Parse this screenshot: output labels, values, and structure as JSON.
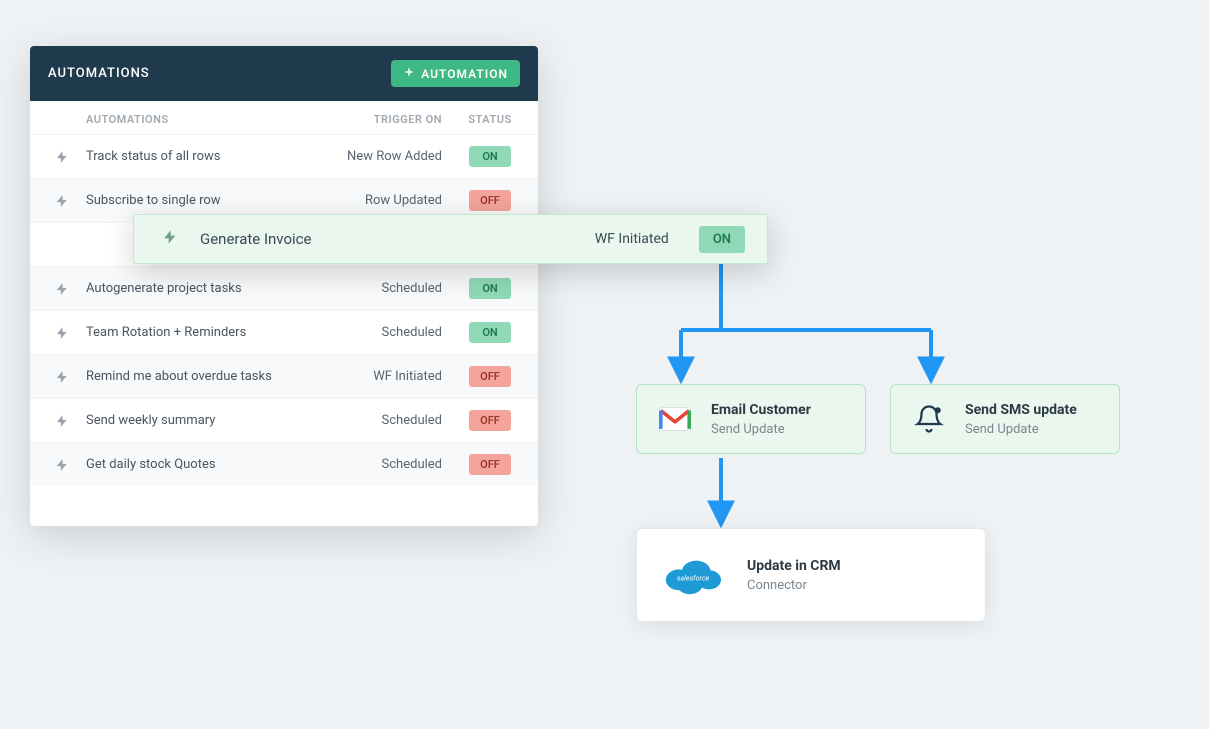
{
  "panel": {
    "title": "AUTOMATIONS",
    "add_button": "AUTOMATION",
    "headers": {
      "name": "AUTOMATIONS",
      "trigger": "TRIGGER ON",
      "status": "STATUS"
    }
  },
  "rows": [
    {
      "name": "Track status of all rows",
      "trigger": "New Row Added",
      "status": "ON"
    },
    {
      "name": "Subscribe to single row",
      "trigger": "Row Updated",
      "status": "OFF"
    },
    {
      "name": "Autogenerate project tasks",
      "trigger": "Scheduled",
      "status": "ON"
    },
    {
      "name": "Team Rotation + Reminders",
      "trigger": "Scheduled",
      "status": "ON"
    },
    {
      "name": "Remind me about overdue tasks",
      "trigger": "WF Initiated",
      "status": "OFF"
    },
    {
      "name": "Send weekly summary",
      "trigger": "Scheduled",
      "status": "OFF"
    },
    {
      "name": "Get daily stock Quotes",
      "trigger": "Scheduled",
      "status": "OFF"
    }
  ],
  "highlighted": {
    "name": "Generate Invoice",
    "trigger": "WF Initiated",
    "status": "ON"
  },
  "flow": {
    "email": {
      "title": "Email Customer",
      "sub": "Send Update"
    },
    "sms": {
      "title": "Send SMS update",
      "sub": "Send Update"
    },
    "crm": {
      "title": "Update in CRM",
      "sub": "Connector"
    }
  },
  "colors": {
    "accent_green": "#3fb984",
    "badge_on_bg": "#8fd9b6",
    "badge_off_bg": "#f4a49a",
    "flow_blue": "#2196F3"
  }
}
